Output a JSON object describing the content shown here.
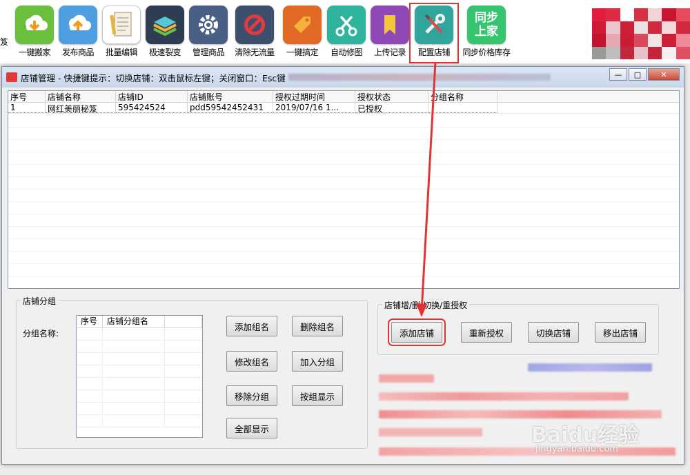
{
  "toolbar": {
    "edge_text": "笈",
    "items": [
      {
        "label": "一键搬家",
        "icon": "download-cloud-icon",
        "color": "#6abf3c"
      },
      {
        "label": "发布商品",
        "icon": "upload-cloud-icon",
        "color": "#4f9fe0"
      },
      {
        "label": "批量编辑",
        "icon": "edit-document-icon",
        "color": "#5aa7d8"
      },
      {
        "label": "极速裂变",
        "icon": "layers-icon",
        "color": "#36a8a0"
      },
      {
        "label": "管理商品",
        "icon": "gear-icon",
        "color": "#4a5f86"
      },
      {
        "label": "清除无流量",
        "icon": "forbidden-icon",
        "color": "#3d4f6c"
      },
      {
        "label": "一键搞定",
        "icon": "tag-icon",
        "color": "#e06a25"
      },
      {
        "label": "自动修图",
        "icon": "scissors-icon",
        "color": "#2eb39d"
      },
      {
        "label": "上传记录",
        "icon": "bookmark-icon",
        "color": "#8e49b6"
      },
      {
        "label": "配置店铺",
        "icon": "wrench-screwdriver-icon",
        "color": "#2fa59c"
      },
      {
        "label": "同步价格库存",
        "icon": "sync-home-icon",
        "color": "#36c46e",
        "icon_text": [
          "同步",
          "上家"
        ]
      }
    ]
  },
  "dialog": {
    "title": "店铺管理 - 快捷键提示：切换店铺：双击鼠标左键；关闭窗口：Esc键",
    "window_buttons": {
      "minimize": "—",
      "maximize": "□",
      "close": "✕"
    }
  },
  "table": {
    "columns": [
      "序号",
      "店铺名称",
      "店铺ID",
      "店铺账号",
      "授权过期时间",
      "授权状态",
      "分组名称"
    ],
    "rows": [
      [
        "1",
        "网红美丽秘笈",
        "595424524",
        "pdd59542452431",
        "2019/07/16 1...",
        "已授权",
        ""
      ]
    ]
  },
  "group_panel": {
    "legend": "店铺分组",
    "group_name_label": "分组名称:",
    "list_columns": [
      "序号",
      "店铺分组名"
    ],
    "buttons": [
      "添加组名",
      "删除组名",
      "修改组名",
      "加入分组",
      "移除分组",
      "按组显示",
      "全部显示"
    ]
  },
  "store_panel": {
    "legend": "店铺增/删/切换/重授权",
    "buttons": [
      "添加店铺",
      "重新授权",
      "切换店铺",
      "移出店铺"
    ]
  },
  "watermark": {
    "main": "Baidu经验",
    "sub": "jingyan.baidu.com"
  },
  "colors": {
    "highlight": "#e03434",
    "titlebar": "#c8d7ea"
  }
}
